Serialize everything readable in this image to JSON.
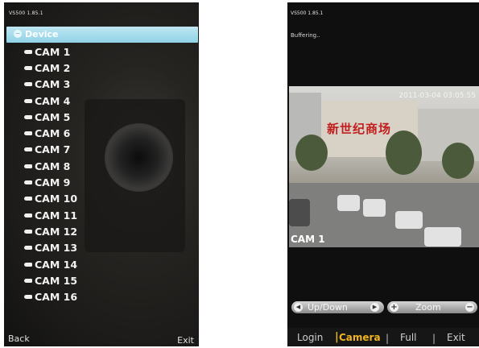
{
  "left_screen": {
    "title": "VS500 1.85.1",
    "tree_root": "Device",
    "toggle_symbol": "−",
    "cameras": [
      "CAM 1",
      "CAM 2",
      "CAM 3",
      "CAM 4",
      "CAM 5",
      "CAM 6",
      "CAM 7",
      "CAM 8",
      "CAM 9",
      "CAM 10",
      "CAM 11",
      "CAM 12",
      "CAM 13",
      "CAM 14",
      "CAM 15",
      "CAM 16"
    ],
    "softkey_left": "Back",
    "softkey_right": "Exit"
  },
  "right_screen": {
    "title": "VS500 1.85.1",
    "status": "Buffering..",
    "video": {
      "timestamp": "2011-03-04 03:05:55",
      "sign_text": "新世纪商场",
      "camera_label": "CAM 1"
    },
    "controls": {
      "updown_label": "Up/Down",
      "zoom_label": "Zoom",
      "left_arrow": "◀",
      "right_arrow": "▶",
      "zoom_in": "+",
      "zoom_out": "−"
    },
    "menu": {
      "login": "Login",
      "camera": "Camera",
      "full": "Full",
      "exit": "Exit",
      "separator": "|"
    }
  },
  "colors": {
    "accent_selected": "#f0b41f",
    "device_bar": "#8fd3e6"
  }
}
